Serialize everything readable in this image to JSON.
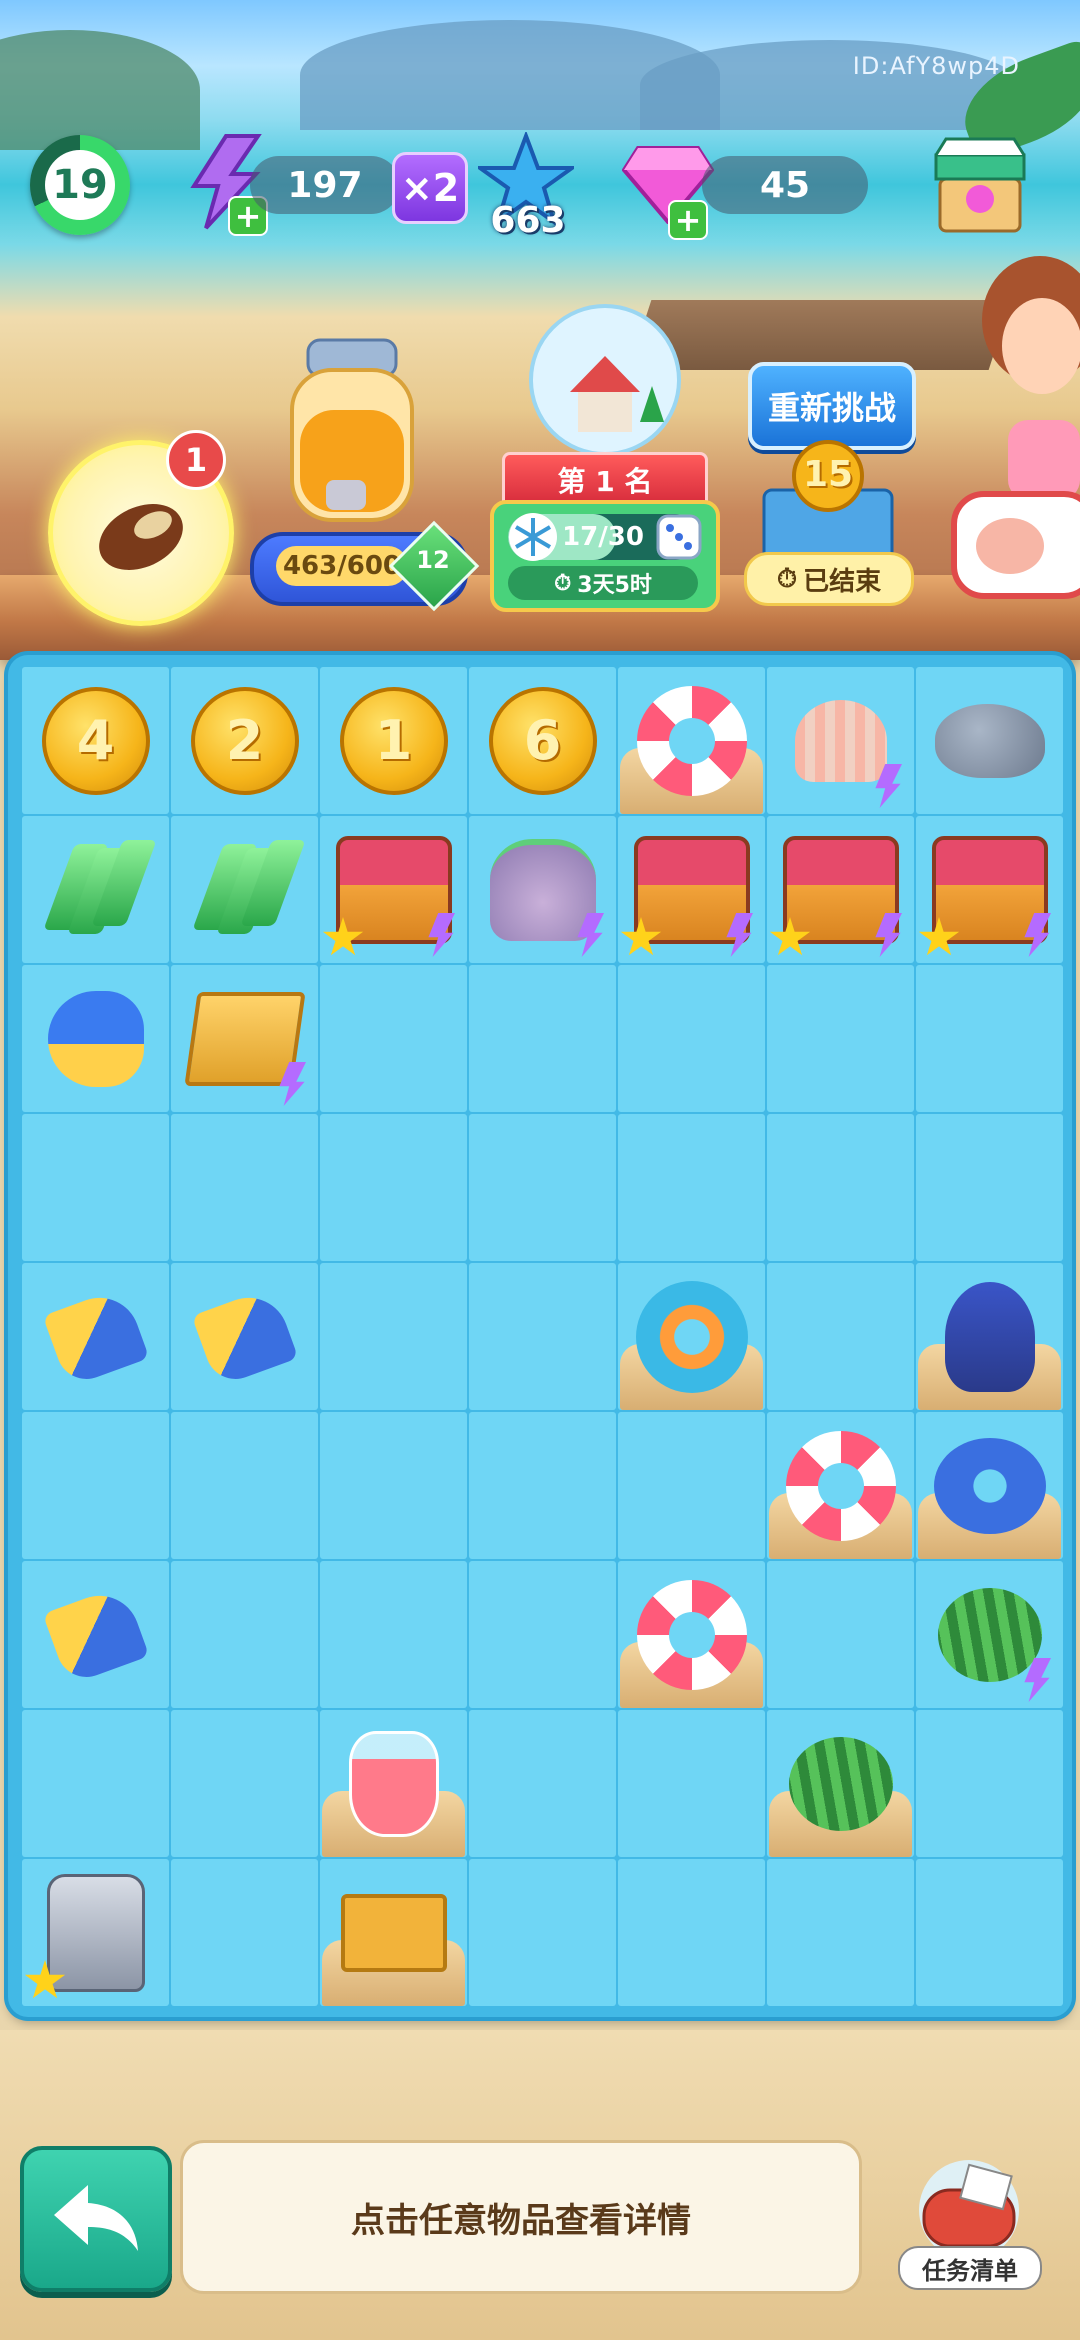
{
  "header": {
    "player_id": "ID:AfY8wp4D",
    "level": "19",
    "energy": "197",
    "energy_multiplier": "×2",
    "stars": "663",
    "gems": "45"
  },
  "panel": {
    "seed_badge": "1",
    "jar_progress": "463/600",
    "jar_level": "12",
    "rank_label": "第 1 名",
    "event_progress": "17/30",
    "event_progress_fraction": 0.567,
    "event_time": "3天5时",
    "rechallenge_label": "重新挑战",
    "token_value": "15",
    "ended_label": "已结束"
  },
  "board": {
    "rows": [
      [
        {
          "t": "coin",
          "v": "4"
        },
        {
          "t": "coin",
          "v": "2"
        },
        {
          "t": "coin",
          "v": "1"
        },
        {
          "t": "coin",
          "v": "6"
        },
        {
          "t": "float-ring",
          "sand": true
        },
        {
          "t": "shell",
          "zap": true
        },
        {
          "t": "rock"
        }
      ],
      [
        {
          "t": "bolt"
        },
        {
          "t": "bolt"
        },
        {
          "t": "chest",
          "star": true,
          "zap": true
        },
        {
          "t": "coral",
          "zap": true
        },
        {
          "t": "chest",
          "star": true,
          "zap": true
        },
        {
          "t": "chest",
          "star": true,
          "zap": true
        },
        {
          "t": "chest",
          "star": true,
          "zap": true
        }
      ],
      [
        {
          "t": "can"
        },
        {
          "t": "basket",
          "zap": true
        },
        {},
        {},
        {},
        {},
        {}
      ],
      [
        {},
        {},
        {},
        {},
        {},
        {},
        {}
      ],
      [
        {
          "t": "scoop"
        },
        {
          "t": "scoop"
        },
        {},
        {},
        {
          "t": "donut",
          "sand": true
        },
        {},
        {
          "t": "bird",
          "sand": true
        }
      ],
      [
        {},
        {},
        {},
        {},
        {},
        {
          "t": "float-ring",
          "sand": true
        },
        {
          "t": "ring-whale",
          "sand": true
        }
      ],
      [
        {
          "t": "scoop"
        },
        {},
        {},
        {},
        {
          "t": "float-ring",
          "sand": true
        },
        {},
        {
          "t": "melon",
          "zap": true
        }
      ],
      [
        {},
        {},
        {
          "t": "juice",
          "sand": true
        },
        {},
        {},
        {
          "t": "melon",
          "sand": true
        },
        {}
      ],
      [
        {
          "t": "machine",
          "star": true
        },
        {},
        {
          "t": "box",
          "sand": true
        },
        {},
        {},
        {},
        {}
      ]
    ]
  },
  "footer": {
    "hint_text": "点击任意物品查看详情",
    "task_label": "任务清单"
  }
}
